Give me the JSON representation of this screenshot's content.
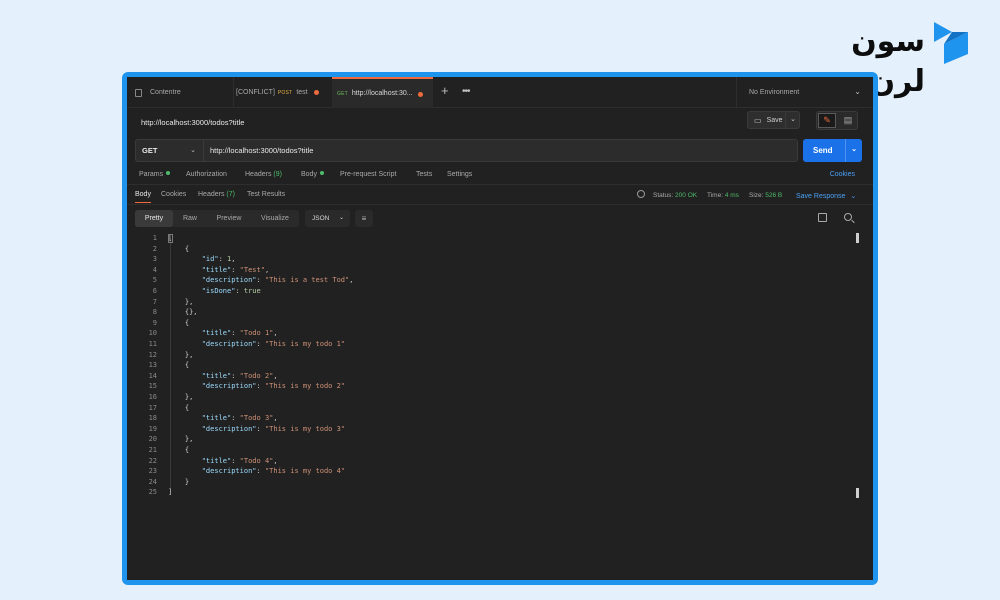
{
  "brand": {
    "logo_text": "سون لرن",
    "accent": "#1f94ee"
  },
  "tabs": [
    {
      "label": "Contentre",
      "method": "",
      "modified": false,
      "active": false
    },
    {
      "label": "test",
      "prefix": "[CONFLICT]",
      "method": "POST",
      "modified": true,
      "active": false
    },
    {
      "label": "http://localhost:30...",
      "method": "GET",
      "modified": true,
      "active": true
    }
  ],
  "environment": {
    "label": "No Environment"
  },
  "request": {
    "title": "http://localhost:3000/todos?title",
    "save_label": "Save",
    "method": "GET",
    "url": "http://localhost:3000/todos?title",
    "send_label": "Send"
  },
  "request_tabs": {
    "params": "Params",
    "authorization": "Authorization",
    "headers": "Headers",
    "headers_count": "(9)",
    "body": "Body",
    "pre_request": "Pre-request Script",
    "tests": "Tests",
    "settings": "Settings",
    "cookies": "Cookies"
  },
  "response_tabs": {
    "body": "Body",
    "cookies": "Cookies",
    "headers": "Headers",
    "headers_count": "(7)",
    "test_results": "Test Results"
  },
  "status": {
    "status_label": "Status:",
    "status_value": "200 OK",
    "time_label": "Time:",
    "time_value": "4 ms",
    "size_label": "Size:",
    "size_value": "526 B",
    "save_response": "Save Response"
  },
  "view": {
    "modes": [
      "Pretty",
      "Raw",
      "Preview",
      "Visualize"
    ],
    "active": "Pretty",
    "format": "JSON"
  },
  "code_lines": [
    [
      [
        "b",
        "["
      ]
    ],
    [
      [
        "b",
        "    {"
      ]
    ],
    [
      [
        "k",
        "        \"id\""
      ],
      [
        "b",
        ": "
      ],
      [
        "n",
        "1"
      ],
      [
        "b",
        ","
      ]
    ],
    [
      [
        "k",
        "        \"title\""
      ],
      [
        "b",
        ": "
      ],
      [
        "s",
        "\"Test\""
      ],
      [
        "b",
        ","
      ]
    ],
    [
      [
        "k",
        "        \"description\""
      ],
      [
        "b",
        ": "
      ],
      [
        "s",
        "\"This is a test Tod\""
      ],
      [
        "b",
        ","
      ]
    ],
    [
      [
        "k",
        "        \"isDone\""
      ],
      [
        "b",
        ": "
      ],
      [
        "n",
        "true"
      ]
    ],
    [
      [
        "b",
        "    },"
      ]
    ],
    [
      [
        "b",
        "    {},"
      ]
    ],
    [
      [
        "b",
        "    {"
      ]
    ],
    [
      [
        "k",
        "        \"title\""
      ],
      [
        "b",
        ": "
      ],
      [
        "s",
        "\"Todo 1\""
      ],
      [
        "b",
        ","
      ]
    ],
    [
      [
        "k",
        "        \"description\""
      ],
      [
        "b",
        ": "
      ],
      [
        "s",
        "\"This is my todo 1\""
      ]
    ],
    [
      [
        "b",
        "    },"
      ]
    ],
    [
      [
        "b",
        "    {"
      ]
    ],
    [
      [
        "k",
        "        \"title\""
      ],
      [
        "b",
        ": "
      ],
      [
        "s",
        "\"Todo 2\""
      ],
      [
        "b",
        ","
      ]
    ],
    [
      [
        "k",
        "        \"description\""
      ],
      [
        "b",
        ": "
      ],
      [
        "s",
        "\"This is my todo 2\""
      ]
    ],
    [
      [
        "b",
        "    },"
      ]
    ],
    [
      [
        "b",
        "    {"
      ]
    ],
    [
      [
        "k",
        "        \"title\""
      ],
      [
        "b",
        ": "
      ],
      [
        "s",
        "\"Todo 3\""
      ],
      [
        "b",
        ","
      ]
    ],
    [
      [
        "k",
        "        \"description\""
      ],
      [
        "b",
        ": "
      ],
      [
        "s",
        "\"This is my todo 3\""
      ]
    ],
    [
      [
        "b",
        "    },"
      ]
    ],
    [
      [
        "b",
        "    {"
      ]
    ],
    [
      [
        "k",
        "        \"title\""
      ],
      [
        "b",
        ": "
      ],
      [
        "s",
        "\"Todo 4\""
      ],
      [
        "b",
        ","
      ]
    ],
    [
      [
        "k",
        "        \"description\""
      ],
      [
        "b",
        ": "
      ],
      [
        "s",
        "\"This is my todo 4\""
      ]
    ],
    [
      [
        "b",
        "    }"
      ]
    ],
    [
      [
        "b",
        "]"
      ]
    ]
  ]
}
